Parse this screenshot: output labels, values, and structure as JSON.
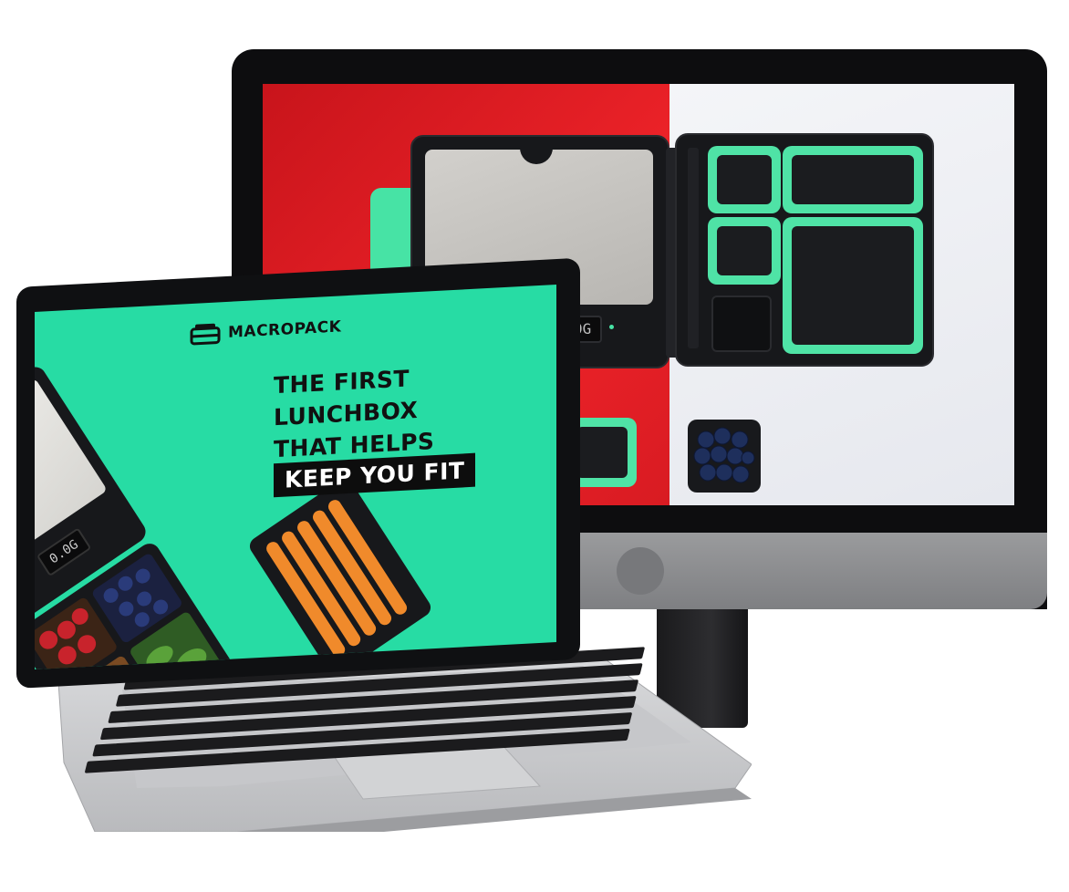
{
  "imac": {
    "scale_readout": "0.0G"
  },
  "macbook": {
    "brand": "MACROPACK",
    "headline_lines": [
      "THE FIRST",
      "LUNCHBOX",
      "THAT HELPS"
    ],
    "headline_highlight": "KEEP YOU FIT",
    "scale_readout": "0.0G"
  },
  "colors": {
    "brand_green": "#27dca4",
    "accent_red": "#ee2329",
    "case_dark": "#17181b"
  }
}
